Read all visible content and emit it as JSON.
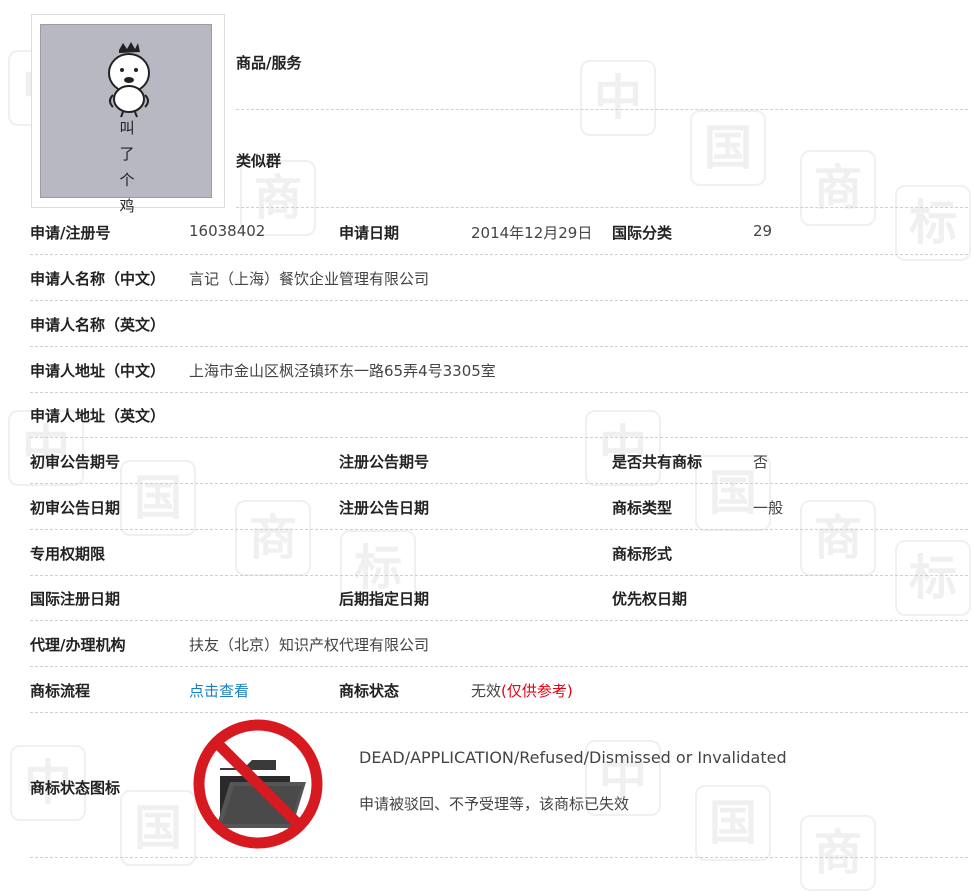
{
  "trademark": {
    "image_text": [
      "叫",
      "了",
      "个",
      "鸡"
    ],
    "goods_services_label": "商品/服务",
    "similar_group_label": "类似群"
  },
  "rows": {
    "reg_no_label": "申请/注册号",
    "reg_no": "16038402",
    "apply_date_label": "申请日期",
    "apply_date": "2014年12月29日",
    "intl_class_label": "国际分类",
    "intl_class": "29",
    "applicant_cn_label": "申请人名称（中文）",
    "applicant_cn": "言记（上海）餐饮企业管理有限公司",
    "applicant_en_label": "申请人名称（英文）",
    "address_cn_label": "申请人地址（中文）",
    "address_cn": "上海市金山区枫泾镇环东一路65弄4号3305室",
    "address_en_label": "申请人地址（英文）",
    "prelim_pub_no_label": "初审公告期号",
    "reg_pub_no_label": "注册公告期号",
    "shared_mark_label": "是否共有商标",
    "shared_mark": "否",
    "prelim_pub_date_label": "初审公告日期",
    "reg_pub_date_label": "注册公告日期",
    "mark_type_label": "商标类型",
    "mark_type": "一般",
    "exclusive_term_label": "专用权期限",
    "mark_form_label": "商标形式",
    "intl_reg_date_label": "国际注册日期",
    "later_designation_date_label": "后期指定日期",
    "priority_date_label": "优先权日期",
    "agent_label": "代理/办理机构",
    "agent": "扶友（北京）知识产权代理有限公司",
    "process_label": "商标流程",
    "process_link": "点击查看",
    "status_label": "商标状态",
    "status": "无效",
    "status_note": "(仅供参考)",
    "status_icon_label": "商标状态图标",
    "status_en": "DEAD/APPLICATION/Refused/Dismissed or Invalidated",
    "status_cn": "申请被驳回、不予受理等，该商标已失效"
  },
  "colors": {
    "link": "#1a7fc1",
    "status_note": "#e60012",
    "forbidden_sign": "#d71920"
  },
  "icons": {
    "status_icon": "forbidden-folder-icon",
    "trademark_image": "chick-cartoon-image"
  },
  "watermark": [
    "中",
    "国",
    "商",
    "标"
  ]
}
